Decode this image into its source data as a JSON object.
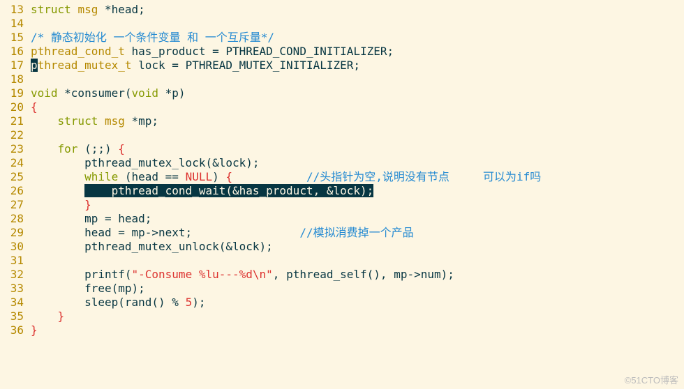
{
  "watermark": "©51CTO博客",
  "lines": [
    {
      "n": 13,
      "tokens": [
        {
          "cls": "kw",
          "t": "struct"
        },
        {
          "cls": "ident",
          "t": " "
        },
        {
          "cls": "type",
          "t": "msg"
        },
        {
          "cls": "ident",
          "t": " *head;"
        }
      ]
    },
    {
      "n": 14,
      "tokens": []
    },
    {
      "n": 15,
      "tokens": [
        {
          "cls": "cmt",
          "t": "/* 静态初始化 一个条件变量 和 一个互斥量*/"
        }
      ]
    },
    {
      "n": 16,
      "tokens": [
        {
          "cls": "type",
          "t": "pthread_cond_t"
        },
        {
          "cls": "ident",
          "t": " has_product = PTHREAD_COND_INITIALIZER;"
        }
      ]
    },
    {
      "n": 17,
      "tokens": [
        {
          "cls": "cursor-block",
          "t": "p"
        },
        {
          "cls": "type",
          "t": "thread_mutex_t"
        },
        {
          "cls": "ident",
          "t": " lock = PTHREAD_MUTEX_INITIALIZER;"
        }
      ]
    },
    {
      "n": 18,
      "tokens": []
    },
    {
      "n": 19,
      "tokens": [
        {
          "cls": "kw",
          "t": "void"
        },
        {
          "cls": "ident",
          "t": " *consumer("
        },
        {
          "cls": "kw",
          "t": "void"
        },
        {
          "cls": "ident",
          "t": " *p)"
        }
      ]
    },
    {
      "n": 20,
      "tokens": [
        {
          "cls": "brace",
          "t": "{"
        }
      ]
    },
    {
      "n": 21,
      "tokens": [
        {
          "cls": "ident",
          "t": "    "
        },
        {
          "cls": "kw",
          "t": "struct"
        },
        {
          "cls": "ident",
          "t": " "
        },
        {
          "cls": "type",
          "t": "msg"
        },
        {
          "cls": "ident",
          "t": " *mp;"
        }
      ]
    },
    {
      "n": 22,
      "tokens": []
    },
    {
      "n": 23,
      "tokens": [
        {
          "cls": "ident",
          "t": "    "
        },
        {
          "cls": "kw",
          "t": "for"
        },
        {
          "cls": "ident",
          "t": " (;;) "
        },
        {
          "cls": "brace",
          "t": "{"
        }
      ]
    },
    {
      "n": 24,
      "tokens": [
        {
          "cls": "ident",
          "t": "        pthread_mutex_lock(&lock);"
        }
      ]
    },
    {
      "n": 25,
      "tokens": [
        {
          "cls": "ident",
          "t": "        "
        },
        {
          "cls": "kw",
          "t": "while"
        },
        {
          "cls": "ident",
          "t": " (head == "
        },
        {
          "cls": "null",
          "t": "NULL"
        },
        {
          "cls": "ident",
          "t": ") "
        },
        {
          "cls": "brace",
          "t": "{"
        },
        {
          "cls": "ident",
          "t": "           "
        },
        {
          "cls": "cmt",
          "t": "//头指针为空,说明没有节点     可以为if吗"
        }
      ]
    },
    {
      "n": 26,
      "tokens": [
        {
          "cls": "ident",
          "t": "        "
        },
        {
          "cls": "selbg",
          "t": "    pthread_cond_wait(&has_product, &lock);"
        }
      ]
    },
    {
      "n": 27,
      "tokens": [
        {
          "cls": "ident",
          "t": "        "
        },
        {
          "cls": "brace",
          "t": "}"
        }
      ]
    },
    {
      "n": 28,
      "tokens": [
        {
          "cls": "ident",
          "t": "        mp = head;"
        }
      ]
    },
    {
      "n": 29,
      "tokens": [
        {
          "cls": "ident",
          "t": "        head = mp->next;                "
        },
        {
          "cls": "cmt",
          "t": "//模拟消费掉一个产品"
        }
      ]
    },
    {
      "n": 30,
      "tokens": [
        {
          "cls": "ident",
          "t": "        pthread_mutex_unlock(&lock);"
        }
      ]
    },
    {
      "n": 31,
      "tokens": []
    },
    {
      "n": 32,
      "tokens": [
        {
          "cls": "ident",
          "t": "        printf("
        },
        {
          "cls": "str",
          "t": "\"-Consume %lu---%d\\n\""
        },
        {
          "cls": "ident",
          "t": ", pthread_self(), mp->num);"
        }
      ]
    },
    {
      "n": 33,
      "tokens": [
        {
          "cls": "ident",
          "t": "        free(mp);"
        }
      ]
    },
    {
      "n": 34,
      "tokens": [
        {
          "cls": "ident",
          "t": "        sleep(rand() % "
        },
        {
          "cls": "num",
          "t": "5"
        },
        {
          "cls": "ident",
          "t": ");"
        }
      ]
    },
    {
      "n": 35,
      "tokens": [
        {
          "cls": "ident",
          "t": "    "
        },
        {
          "cls": "brace",
          "t": "}"
        }
      ]
    },
    {
      "n": 36,
      "tokens": [
        {
          "cls": "brace",
          "t": "}"
        }
      ]
    }
  ]
}
